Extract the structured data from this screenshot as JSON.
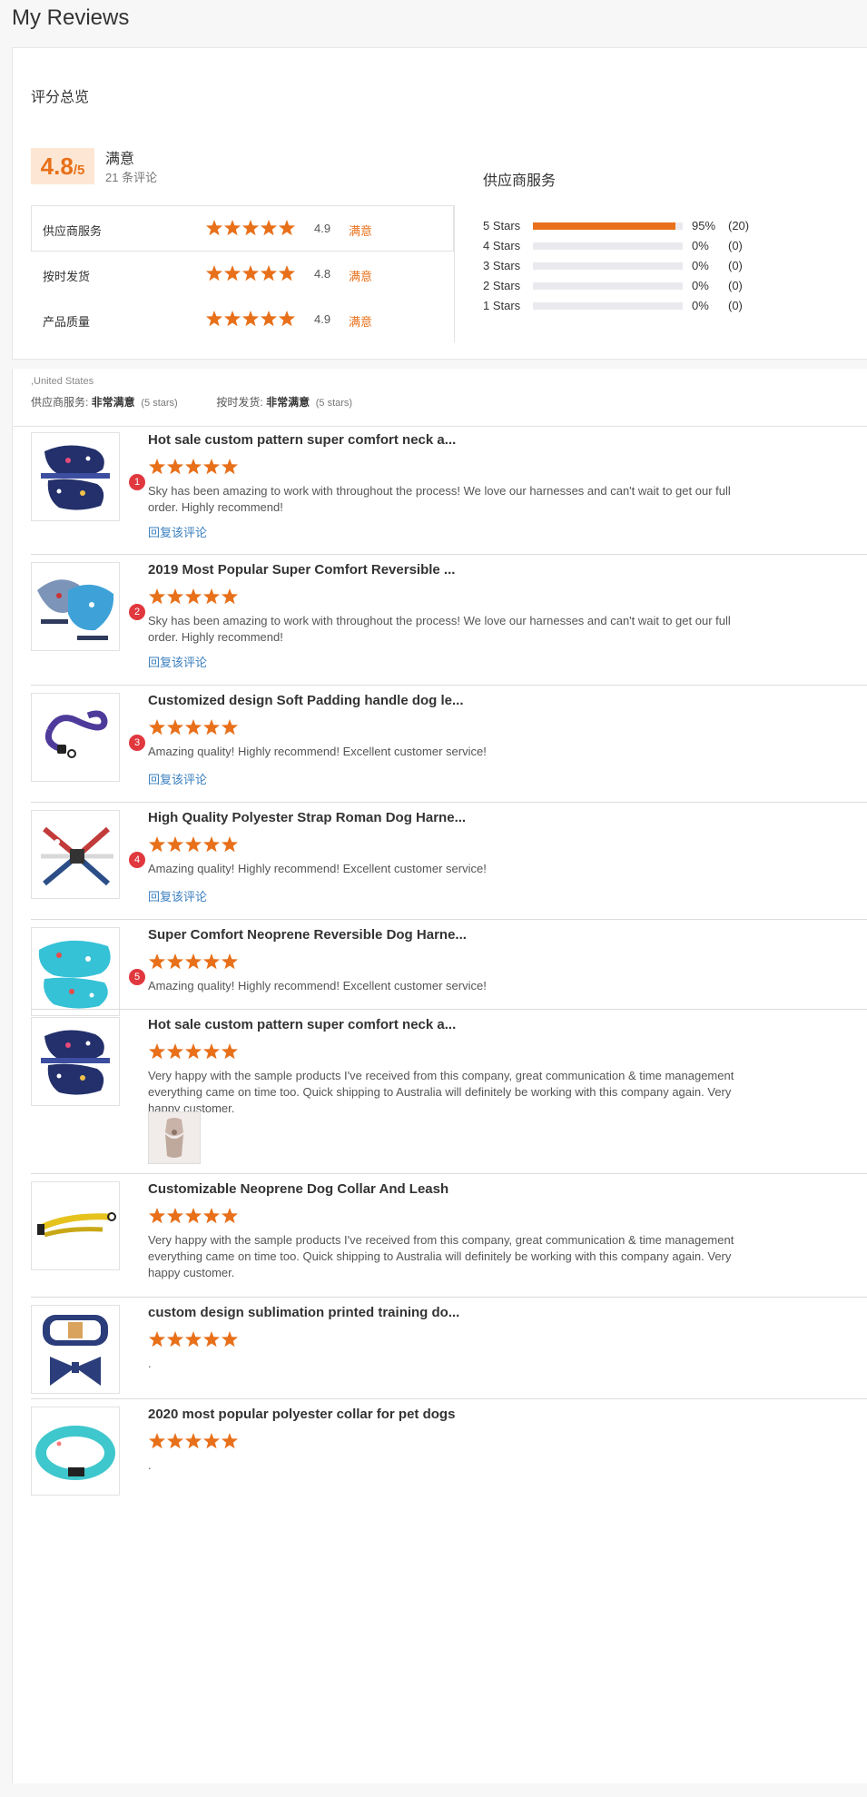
{
  "page": {
    "title": "My Reviews"
  },
  "overview": {
    "title": "评分总览",
    "score": "4.8",
    "score_max": "/5",
    "satisfaction": "满意",
    "review_count": "21 条评论",
    "metrics": [
      {
        "label": "供应商服务",
        "score": "4.9",
        "status": "满意",
        "stars": 5
      },
      {
        "label": "按时发货",
        "score": "4.8",
        "status": "满意",
        "stars": 5
      },
      {
        "label": "产品质量",
        "score": "4.9",
        "status": "满意",
        "stars": 5
      }
    ],
    "supplier_title": "供应商服务",
    "distribution": [
      {
        "label": "5 Stars",
        "fraction": 0.95,
        "percent": "95%",
        "count": "(20)"
      },
      {
        "label": "4 Stars",
        "fraction": 0,
        "percent": "0%",
        "count": "(0)"
      },
      {
        "label": "3 Stars",
        "fraction": 0,
        "percent": "0%",
        "count": "(0)"
      },
      {
        "label": "2 Stars",
        "fraction": 0,
        "percent": "0%",
        "count": "(0)"
      },
      {
        "label": "1 Stars",
        "fraction": 0,
        "percent": "0%",
        "count": "(0)"
      }
    ]
  },
  "buyer": {
    "country": ",United States",
    "supplier_label": "供应商服务: ",
    "supplier_value": "非常满意",
    "supplier_stars": "(5 stars)",
    "shipping_label": "按时发货: ",
    "shipping_value": "非常满意",
    "shipping_stars": "(5 stars)"
  },
  "reviews": [
    {
      "title": "Hot sale custom pattern super comfort neck a...",
      "stars": 5,
      "badge": "1",
      "text": "Sky has been amazing to work with throughout the process!  We love our harnesses and can't wait to get our full order.  Highly recommend!",
      "reply": "回复该评论",
      "thumb": "harness-navy"
    },
    {
      "title": "2019 Most Popular Super Comfort Reversible ...",
      "stars": 5,
      "badge": "2",
      "text": "Sky has been amazing to work with throughout the process!  We love our harnesses and can't wait to get our full order.  Highly recommend!",
      "reply": "回复该评论",
      "thumb": "harness-blue"
    },
    {
      "title": "Customized design Soft Padding handle dog le...",
      "stars": 5,
      "badge": "3",
      "text": "Amazing quality!  Highly recommend! Excellent customer service!",
      "reply": "回复该评论",
      "thumb": "leash-purple"
    },
    {
      "title": "High Quality Polyester Strap Roman Dog Harne...",
      "stars": 5,
      "badge": "4",
      "text": "Amazing quality!  Highly recommend! Excellent customer service!",
      "reply": "回复该评论",
      "thumb": "harness-roman"
    },
    {
      "title": "Super Comfort Neoprene Reversible Dog Harne...",
      "stars": 5,
      "badge": "5",
      "text": "Amazing quality!  Highly recommend! Excellent customer service!",
      "thumb": "harness-cyan"
    },
    {
      "title": "Hot sale custom pattern super comfort neck a...",
      "stars": 5,
      "text": "Very happy with the sample products I've received from this company, great communication & time management everything came on time too. Quick shipping to Australia will definitely be working with this company again. Very happy customer.",
      "has_photo": true,
      "thumb": "harness-navy"
    },
    {
      "title": "Customizable Neoprene Dog Collar And Leash",
      "stars": 5,
      "text": "Very happy with the sample products I've received from this company, great communication & time management everything came on time too. Quick shipping to Australia will definitely be working with this company again. Very happy customer.",
      "thumb": "leash-yellow"
    },
    {
      "title": "custom design sublimation printed training do...",
      "stars": 5,
      "text": ".",
      "thumb": "collar-plaid"
    },
    {
      "title": "2020 most popular polyester collar for pet dogs",
      "stars": 5,
      "text": ".",
      "thumb": "collar-cyan"
    }
  ],
  "colors": {
    "accent": "#e8701a",
    "badge": "#e0383e",
    "link": "#3a7fbf"
  }
}
